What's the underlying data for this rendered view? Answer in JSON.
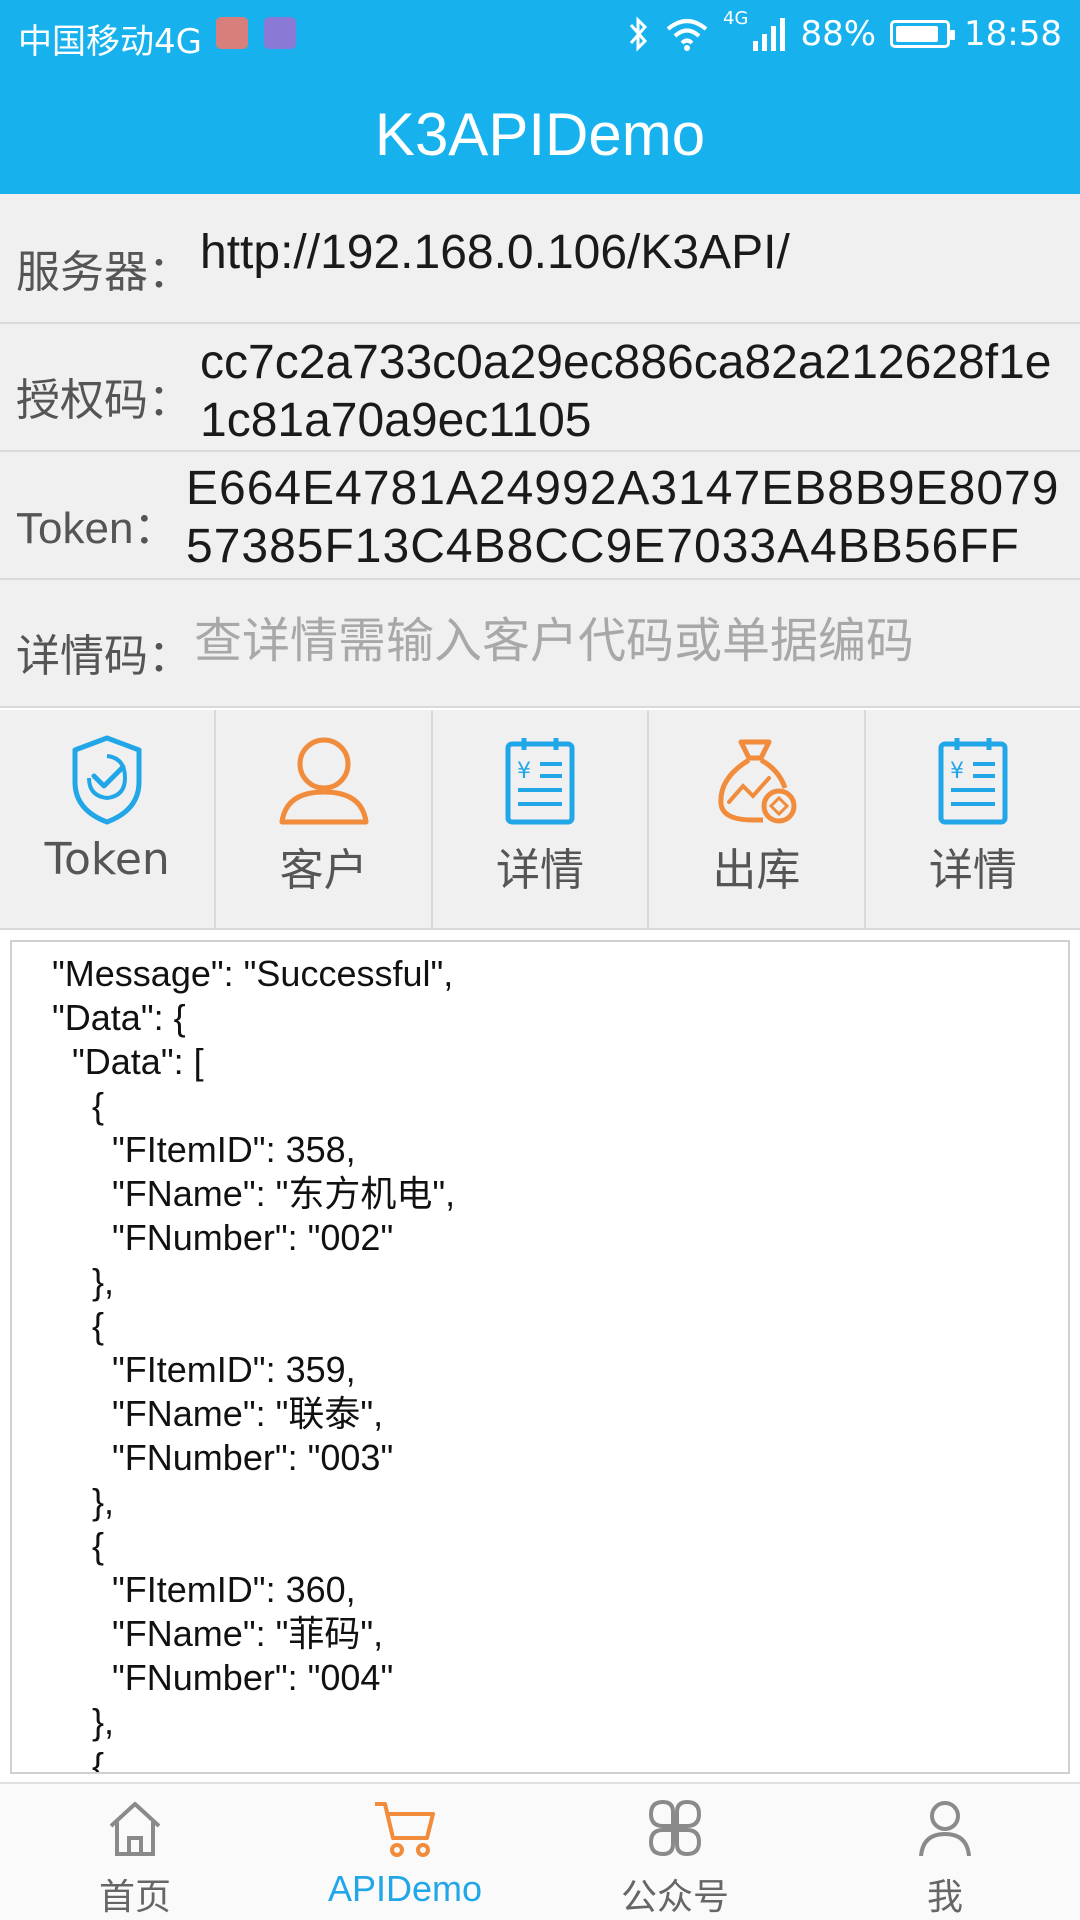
{
  "status_bar": {
    "carrier": "中国移动4G",
    "network": "4G",
    "battery": "88%",
    "battery_level": 0.88,
    "time": "18:58",
    "icons": [
      "mail-notification-icon",
      "image-notification-icon",
      "bluetooth-icon",
      "wifi-icon",
      "signal-icon",
      "battery-icon"
    ]
  },
  "app_bar": {
    "title": "K3APIDemo",
    "color": "#17b2ee"
  },
  "form": {
    "server": {
      "label": "服务器：",
      "value": "http://192.168.0.106/K3API/"
    },
    "auth_code": {
      "label": "授权码：",
      "value": "cc7c2a733c0a29ec886ca82a212628f1e1c81a70a9ec1105"
    },
    "token": {
      "label": "Token：",
      "value": "E664E4781A24992A3147EB8B9E807957385F13C4B8CC9E7033A4BB56FF"
    },
    "detail_code": {
      "label": "详情码：",
      "value": "",
      "placeholder": "查详情需输入客户代码或单据编码"
    }
  },
  "actions": [
    {
      "label": "Token",
      "icon": "shield-check-icon",
      "color": "#21a6e8"
    },
    {
      "label": "客户",
      "icon": "person-icon",
      "color": "#f08c3c"
    },
    {
      "label": "详情",
      "icon": "invoice-icon",
      "color": "#21a6e8"
    },
    {
      "label": "出库",
      "icon": "money-bag-icon",
      "color": "#f08c3c"
    },
    {
      "label": "详情",
      "icon": "invoice-icon",
      "color": "#21a6e8"
    }
  ],
  "output": {
    "text": " \"Message\": \"Successful\",\n \"Data\": {\n   \"Data\": [\n     {\n       \"FItemID\": 358,\n       \"FName\": \"东方机电\",\n       \"FNumber\": \"002\"\n     },\n     {\n       \"FItemID\": 359,\n       \"FName\": \"联泰\",\n       \"FNumber\": \"003\"\n     },\n     {\n       \"FItemID\": 360,\n       \"FName\": \"菲码\",\n       \"FNumber\": \"004\"\n     },\n     {"
  },
  "bottom_nav": [
    {
      "label": "首页",
      "icon": "home-icon",
      "active": false
    },
    {
      "label": "APIDemo",
      "icon": "cart-icon",
      "active": true
    },
    {
      "label": "公众号",
      "icon": "apps-icon",
      "active": false
    },
    {
      "label": "我",
      "icon": "profile-icon",
      "active": false
    }
  ],
  "colors": {
    "accent": "#17b2ee",
    "active_tab": "#21a6e8",
    "orange": "#f08c3c"
  }
}
